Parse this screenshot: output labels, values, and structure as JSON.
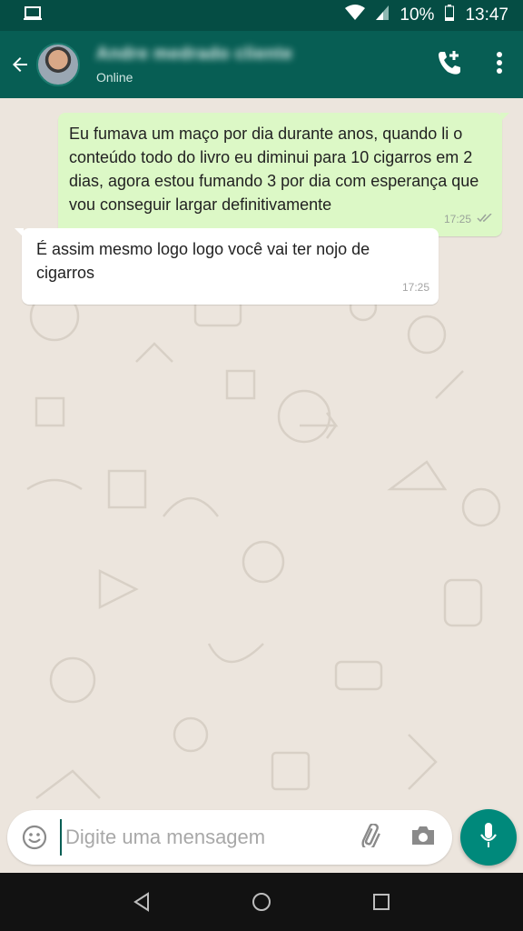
{
  "status_bar": {
    "battery": "10%",
    "time": "13:47",
    "icons": [
      "screen-cast-icon",
      "wifi-icon",
      "signal-icon",
      "battery-icon"
    ]
  },
  "header": {
    "contact_name": "Andre medrado cliente",
    "contact_status": "Online",
    "icons": [
      "back-arrow-icon",
      "avatar",
      "add-call-icon",
      "more-vert-icon"
    ]
  },
  "messages": [
    {
      "direction": "outgoing",
      "text": "Eu fumava um maço por dia durante anos, quando li o conteúdo todo do livro eu diminui para 10 cigarros em 2 dias, agora estou fumando 3 por dia com esperança que vou conseguir largar definitivamente",
      "time": "17:25",
      "status_icon": "double-check-icon"
    },
    {
      "direction": "incoming",
      "text": "É assim mesmo logo logo você vai ter nojo de cigarros",
      "time": "17:25"
    }
  ],
  "composer": {
    "placeholder": "Digite uma mensagem",
    "icons": [
      "emoji-icon",
      "attach-icon",
      "camera-icon",
      "mic-icon"
    ]
  },
  "nav_bar": {
    "icons": [
      "nav-back-icon",
      "nav-home-icon",
      "nav-recents-icon"
    ]
  },
  "colors": {
    "header": "#075e54",
    "status_bar": "#054d44",
    "outgoing_bubble": "#dcf8c6",
    "incoming_bubble": "#ffffff",
    "chat_background": "#ece5dd",
    "accent": "#00897b"
  }
}
